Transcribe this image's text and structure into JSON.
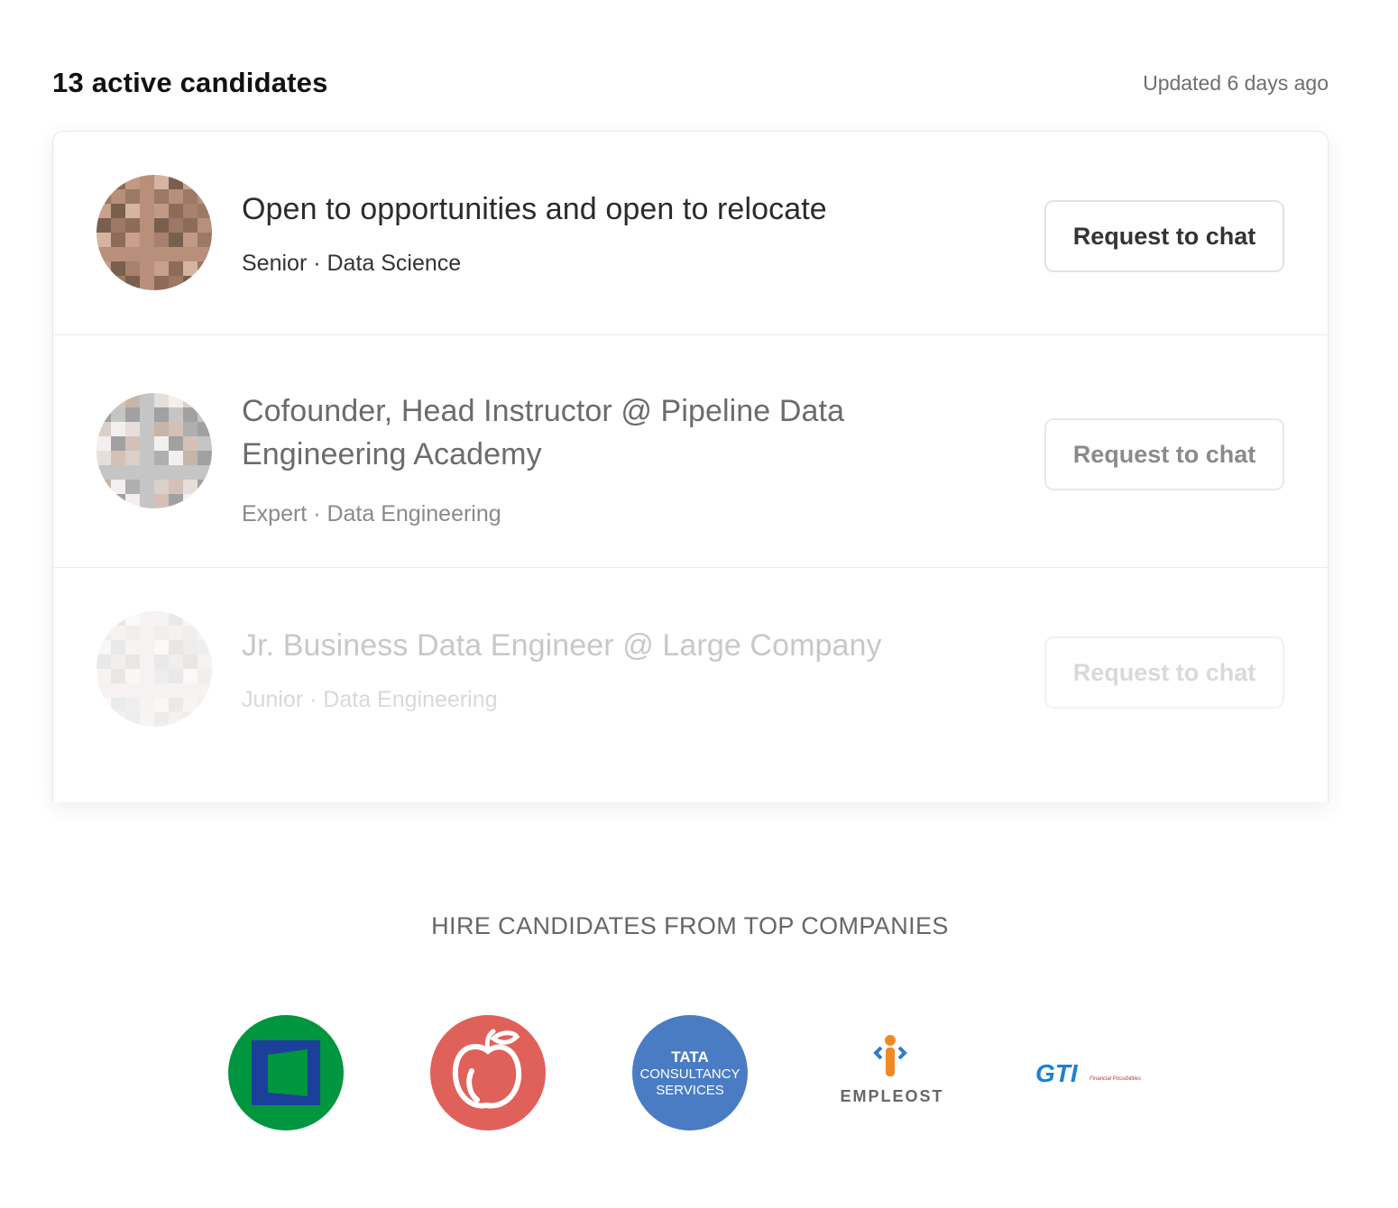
{
  "header": {
    "title": "13 active candidates",
    "updated": "Updated 6 days ago"
  },
  "candidates": [
    {
      "headline": "Open to opportunities and open to relocate",
      "meta": "Senior · Data Science",
      "button_label": "Request to chat"
    },
    {
      "headline": "Cofounder, Head Instructor @ Pipeline Data Engineering Academy",
      "meta": "Expert · Data Engineering",
      "button_label": "Request to chat"
    },
    {
      "headline": "Jr. Business Data Engineer @ Large Company",
      "meta": "Junior · Data Engineering",
      "button_label": "Request to chat"
    }
  ],
  "companies_section": {
    "heading": "HIRE CANDIDATES FROM TOP COMPANIES",
    "logos": [
      {
        "name": "green-square-company-logo",
        "color": "#00963f"
      },
      {
        "name": "apple-company-logo",
        "color": "#e0605a"
      },
      {
        "name": "tcs-logo",
        "color": "#4a7cc4",
        "text_lines": [
          "TATA",
          "CONSULTANCY",
          "SERVICES"
        ]
      },
      {
        "name": "empleost-logo",
        "text": "EMPLEOST"
      },
      {
        "name": "gti-logo",
        "text": "GTI",
        "tagline": "Financial Possibilities"
      }
    ]
  }
}
